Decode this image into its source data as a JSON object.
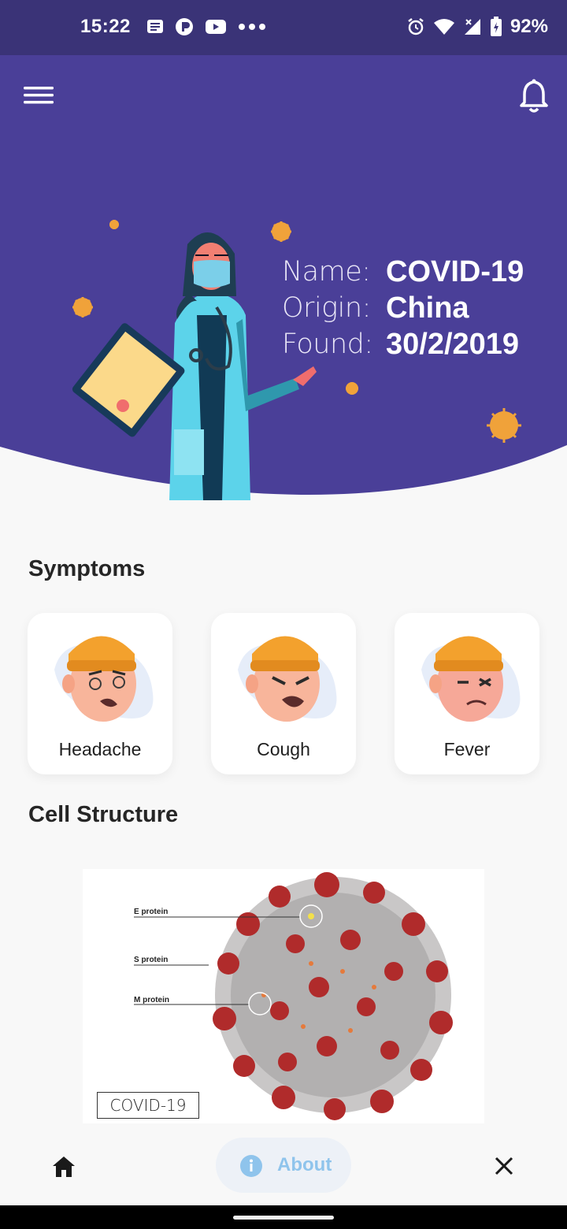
{
  "status_bar": {
    "time": "15:22",
    "battery": "92%",
    "left_icons": [
      "news-icon",
      "app-p-icon",
      "youtube-icon",
      "more-dots-icon"
    ],
    "right_icons": [
      "alarm-icon",
      "wifi-icon",
      "signal-icon",
      "battery-icon"
    ]
  },
  "header": {
    "background_color": "#4a3f98",
    "menu_icon": "hamburger-menu-icon",
    "notification_icon": "bell-icon",
    "illustration": "doctor-with-clipboard-illustration",
    "info": [
      {
        "key": "Name:",
        "value": "COVID-19"
      },
      {
        "key": "Origin:",
        "value": "China"
      },
      {
        "key": "Found:",
        "value": "30/2/2019"
      }
    ]
  },
  "symptoms": {
    "title": "Symptoms",
    "items": [
      {
        "label": "Headache",
        "icon": "headache-face-icon"
      },
      {
        "label": "Cough",
        "icon": "cough-face-icon"
      },
      {
        "label": "Fever",
        "icon": "fever-face-icon"
      }
    ]
  },
  "cell_structure": {
    "title": "Cell Structure",
    "labels": [
      "E protein",
      "S protein",
      "M protein"
    ],
    "tag": "COVID-19"
  },
  "bottom_nav": {
    "home_icon": "home-icon",
    "about_label": "About",
    "about_icon": "info-icon",
    "close_icon": "close-icon",
    "accent_color": "#8fc4ec"
  }
}
